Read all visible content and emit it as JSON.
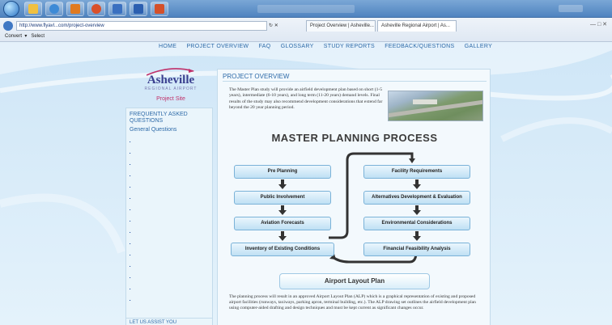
{
  "browser": {
    "url": "http://www.flyavl...com/project-overview",
    "tabs": [
      "Project Overview | Asheville...",
      "Asheville Regional Airport | As..."
    ],
    "command_bar": [
      "Convert",
      "Select"
    ],
    "search_placeholder": ""
  },
  "site": {
    "nav": [
      "HOME",
      "PROJECT OVERVIEW",
      "FAQ",
      "GLOSSARY",
      "STUDY REPORTS",
      "FEEDBACK/QUESTIONS",
      "GALLERY"
    ],
    "logo": {
      "name": "Asheville",
      "subtitle": "REGIONAL AIRPORT",
      "project": "Project Site"
    },
    "sidebar": {
      "faq_title": "FREQUENTLY ASKED QUESTIONS",
      "general_heading": "General Questions",
      "assist": "LET US ASSIST YOU"
    },
    "main": {
      "title": "PROJECT OVERVIEW",
      "intro": "The Master Plan study will provide an airfield development plan based on short (1-5 years), intermediate (6-10 years), and long term (11-20 years) demand levels. Final results of the study may also recommend development considerations that extend far beyond the 20 year planning period.",
      "process_title": "MASTER PLANNING PROCESS",
      "left_steps": [
        "Pre Planning",
        "Public Involvement",
        "Aviation Forecasts",
        "Inventory of Existing Conditions"
      ],
      "right_steps": [
        "Facility Requirements",
        "Alternatives Development & Evaluation",
        "Environmental Considerations",
        "Financial Feasibility Analysis"
      ],
      "final_step": "Airport Layout Plan",
      "closing": "The planning process will result in an approved Airport Layout Plan (ALP) which is a graphical representation of existing and proposed airport facilities (runways, taxiways, parking apron, terminal building, etc.). The ALP drawing set outlines the airfield development plan using computer-aided drafting and design techniques and must be kept current as significant changes occur."
    }
  },
  "colors": {
    "accent": "#2d6aa8",
    "box_fill": "#bfe0f4",
    "flow_line": "#333333"
  }
}
